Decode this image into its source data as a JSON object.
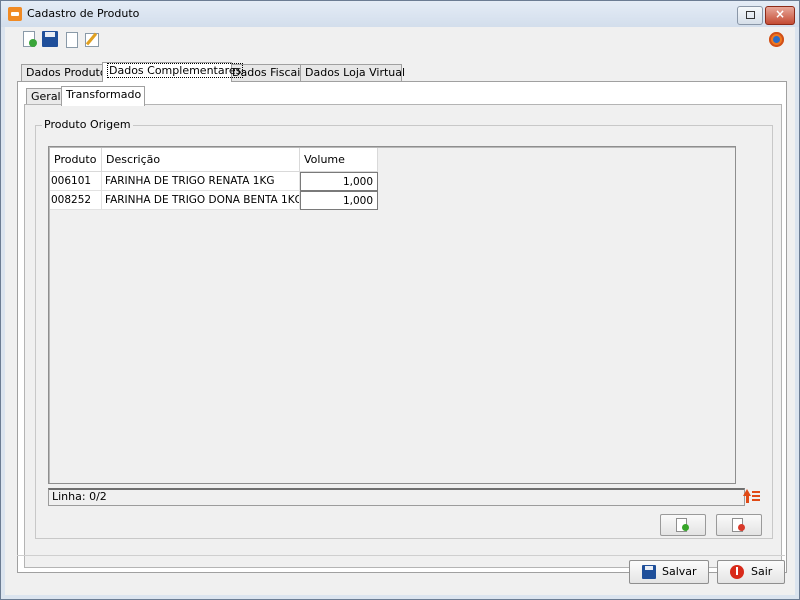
{
  "window": {
    "title": "Cadastro de Produto"
  },
  "toolbar": {
    "icons": [
      "new-document-icon",
      "save-icon",
      "copy-icon",
      "edit-icon"
    ],
    "right_icon": "power-icon"
  },
  "tabs": [
    {
      "label": "Dados Produto"
    },
    {
      "label": "Dados Complementares"
    },
    {
      "label": "Dados Fiscais"
    },
    {
      "label": "Dados Loja Virtual"
    }
  ],
  "subtabs": [
    {
      "label": "Geral"
    },
    {
      "label": "Transformado"
    }
  ],
  "group": {
    "label": "Produto Origem"
  },
  "grid": {
    "headers": [
      "Produto",
      "Descrição",
      "Volume"
    ],
    "rows": [
      {
        "produto": "006101",
        "descricao": "FARINHA DE TRIGO RENATA 1KG",
        "volume": "1,000"
      },
      {
        "produto": "008252",
        "descricao": "FARINHA DE TRIGO DONA BENTA 1KG",
        "volume": "1,000"
      }
    ],
    "status": "Linha: 0/2"
  },
  "buttons": {
    "save": "Salvar",
    "exit": "Sair"
  },
  "colors": {
    "window_bg": "#dbe4ef",
    "accent": "#1f4f9a",
    "close": "#c44b33"
  }
}
